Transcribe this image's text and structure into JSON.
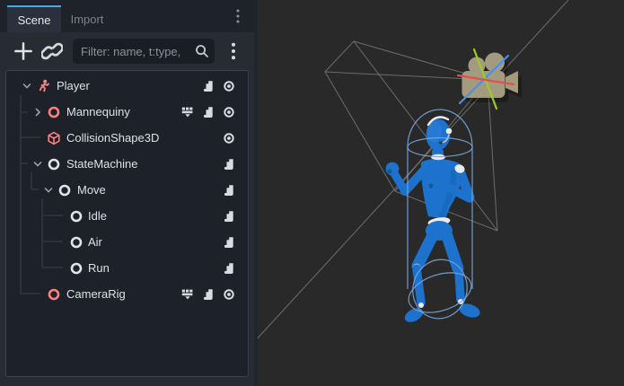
{
  "dock": {
    "tabs": [
      {
        "label": "Scene",
        "active": true
      },
      {
        "label": "Import",
        "active": false
      }
    ],
    "toolbar": {
      "filter_placeholder": "Filter: name, t:type,",
      "add_node_icon": "plus-icon",
      "instance_scene_icon": "link-icon",
      "search_icon": "magnifier-icon",
      "menu_icon": "vertical-dots-icon"
    },
    "tree": [
      {
        "name": "Player",
        "depth": 0,
        "icon": "character-body",
        "arrow": "down",
        "buttons": [
          "script",
          "visibility"
        ]
      },
      {
        "name": "Mannequiny",
        "depth": 1,
        "icon": "node3d-red",
        "arrow": "right",
        "buttons": [
          "film",
          "script",
          "visibility"
        ]
      },
      {
        "name": "CollisionShape3D",
        "depth": 1,
        "icon": "collision-shape",
        "arrow": null,
        "buttons": [
          "visibility"
        ]
      },
      {
        "name": "StateMachine",
        "depth": 1,
        "icon": "node",
        "arrow": "down",
        "buttons": [
          "script"
        ]
      },
      {
        "name": "Move",
        "depth": 2,
        "icon": "node",
        "arrow": "down",
        "buttons": [
          "script"
        ]
      },
      {
        "name": "Idle",
        "depth": 3,
        "icon": "node",
        "arrow": null,
        "buttons": [
          "script"
        ]
      },
      {
        "name": "Air",
        "depth": 3,
        "icon": "node",
        "arrow": null,
        "buttons": [
          "script"
        ]
      },
      {
        "name": "Run",
        "depth": 3,
        "icon": "node",
        "arrow": null,
        "buttons": [
          "script"
        ]
      },
      {
        "name": "CameraRig",
        "depth": 1,
        "icon": "node3d-red",
        "arrow": null,
        "buttons": [
          "film",
          "script",
          "visibility"
        ]
      }
    ]
  },
  "viewport": {
    "content": [
      "mannequin-model",
      "collision-capsule-wireframe",
      "camera-gizmo",
      "camera-frustum-lines"
    ]
  },
  "colors": {
    "accent_blue": "#53a3dc",
    "node_red": "#fc7f7f",
    "node_white": "#e0e3e7",
    "axis_x_red": "#e0504c",
    "axis_y_green": "#9ccb2a",
    "axis_z_blue": "#4a90e8",
    "mannequin_blue": "#1d72cd",
    "camera_khaki": "#a29b80",
    "capsule_wire_blue": "#7aa7dc",
    "frustum_gray": "#868686",
    "viewport_bg": "#292929"
  }
}
